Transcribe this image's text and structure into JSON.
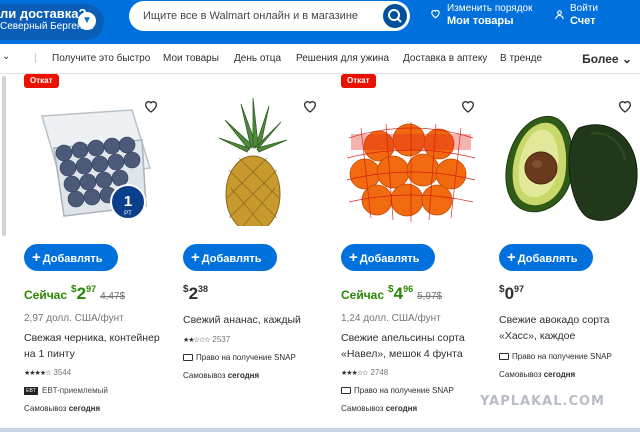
{
  "header": {
    "pickup_line1": "ли доставка?",
    "pickup_line2": "Северный Берген ...",
    "search_placeholder": "Ищите все в Walmart онлайн и в магазине",
    "reorder_line1": "Изменить порядок",
    "reorder_line2": "Мои товары",
    "account_line1": "Войти",
    "account_line2": "Счет"
  },
  "nav": {
    "items": [
      "Получите это быстро",
      "Мои товары",
      "День отца",
      "Решения для ужина",
      "Доставка в аптеку",
      "В тренде"
    ],
    "more": "Более"
  },
  "products": [
    {
      "badge": "Откат",
      "now_label": "Сейчас",
      "dollars": "2",
      "cents": "97",
      "old_price": "4,47$",
      "unit_price": "2,97 долл. США/фунт",
      "title": "Свежая черника, контейнер на 1 пинту",
      "rating": 3.5,
      "stars": "★★★★☆",
      "reviews": "3544",
      "ebt": "EBT-приемлемый",
      "ebt_icon": "EBT",
      "pickup_label": "Самовывоз",
      "pickup_when": "сегодня",
      "pack_badge": "1",
      "pack_unit": "PT",
      "add_label": "Добавлять"
    },
    {
      "dollars": "2",
      "cents": "38",
      "title": "Свежий ананас, каждый",
      "rating": 2,
      "stars": "★★☆☆☆",
      "reviews": "2537",
      "snap": "Право на получение SNAP",
      "pickup_label": "Самовывоз",
      "pickup_when": "сегодня",
      "add_label": "Добавлять"
    },
    {
      "badge": "Откат",
      "now_label": "Сейчас",
      "dollars": "4",
      "cents": "96",
      "old_price": "5,97$",
      "unit_price": "1,24 долл. США/фунт",
      "title": "Свежие апельсины сорта «Навел», мешок 4 фунта",
      "rating": 2.5,
      "stars": "★★★☆☆",
      "reviews": "2748",
      "snap": "Право на получение SNAP",
      "pickup_label": "Самовывоз",
      "pickup_when": "сегодня",
      "add_label": "Добавлять"
    },
    {
      "dollars": "0",
      "cents": "97",
      "title": "Свежие авокадо сорта «Хасс», каждое",
      "snap": "Право на получение SNAP",
      "pickup_label": "Самовывоз",
      "pickup_when": "сегодня",
      "add_label": "Добавлять"
    }
  ],
  "watermark": "YAPLAKAL.COM",
  "colors": {
    "brand_blue": "#0071dc",
    "rollback_red": "#ea1100",
    "price_green": "#2a8703"
  },
  "icons": [
    "chevron-down-icon",
    "search-icon",
    "heart-icon",
    "person-icon",
    "plus-icon",
    "snap-card-icon"
  ]
}
